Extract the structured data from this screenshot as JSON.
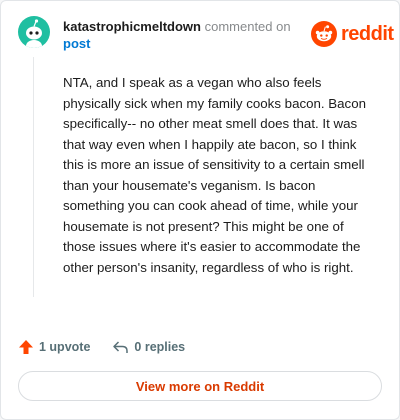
{
  "comment": {
    "username": "katastrophicmeltdown",
    "action_text": "commented on",
    "target": "post",
    "body": "NTA, and I speak as a vegan who also feels physically sick when my family cooks bacon. Bacon specifically-- no other meat smell does that. It was that way even when I happily ate bacon, so I think this is more an issue of sensitivity to a certain smell than your housemate's veganism. Is bacon something you can cook ahead of time, while your housemate is not present? This might be one of those issues where it's easier to accommodate the other person's insanity, regardless of who is right."
  },
  "brand": {
    "wordmark": "reddit",
    "color": "#ff4500"
  },
  "avatar": {
    "background": "#1fbfa1",
    "icon": "snoo-avatar-icon"
  },
  "actions": {
    "upvote_label": "1 upvote",
    "replies_label": "0 replies",
    "upvote_color": "#ff4500"
  },
  "view_more": {
    "label": "View more on Reddit",
    "color": "#d93a00"
  }
}
